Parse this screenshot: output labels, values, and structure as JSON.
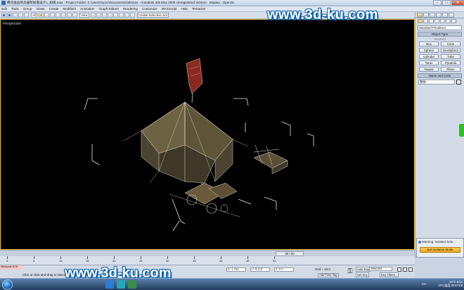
{
  "window": {
    "title": "腾讯金战场兵器架帐篷设计1_如棋.max   ·   Project Folder: C:\\Users\\zyzxr\\Documents\\3dsmax   ·   Autodesk 3ds Max  2009     Unregistered Version   ·   Display : OpenGL",
    "minimize": "–",
    "maximize": "□",
    "close": "✕"
  },
  "menu": [
    "Edit",
    "Tools",
    "Group",
    "Views",
    "Create",
    "Modifiers",
    "Animation",
    "Graph Editors",
    "Rendering",
    "Customize",
    "MAXScript",
    "Help",
    "Tentacles"
  ],
  "toolbar": {
    "filter": "All",
    "view": "View",
    "selection_set": "Create Selection Set"
  },
  "viewport": {
    "label": "Perspective"
  },
  "watermark": "www.3d-ku.com",
  "command_panel": {
    "dropdown": "Standard Primitives",
    "object_type_header": "Object Type",
    "autogrid": "AutoGrid",
    "objects": [
      "Box",
      "Cone",
      "Sphere",
      "GeoSphere",
      "Cylinder",
      "Tube",
      "Torus",
      "Pyramid",
      "Teapot",
      "Plane"
    ],
    "name_color_header": "Name and Color",
    "name_value": "物体"
  },
  "warning": {
    "text": "Warning: Isolated Sele...",
    "exit_button": "Exit Isolation Mode"
  },
  "timeline": {
    "frame": "30 / 50",
    "ticks": [
      "0",
      "5",
      "10",
      "15",
      "20",
      "25",
      "30",
      "35",
      "40",
      "45",
      "50"
    ]
  },
  "status": {
    "maxscript": "Welcome to M",
    "prompt": "Click or click-and-drag to select objects",
    "x": "X: 1.765",
    "y": "Y: 9.213",
    "z": "Z: 0.0",
    "grid": "Grid = 10.0",
    "add_time_tag": "Add Time Tag",
    "auto_key": "Auto Key",
    "set_key": "Set Key",
    "selected": "Selected",
    "key_filters": "Key Filters..."
  },
  "tray": {
    "lang": "CH",
    "temp": "24°C",
    "cpu": "CPU温度",
    "time": "9:52",
    "date": "2017/1/8"
  }
}
